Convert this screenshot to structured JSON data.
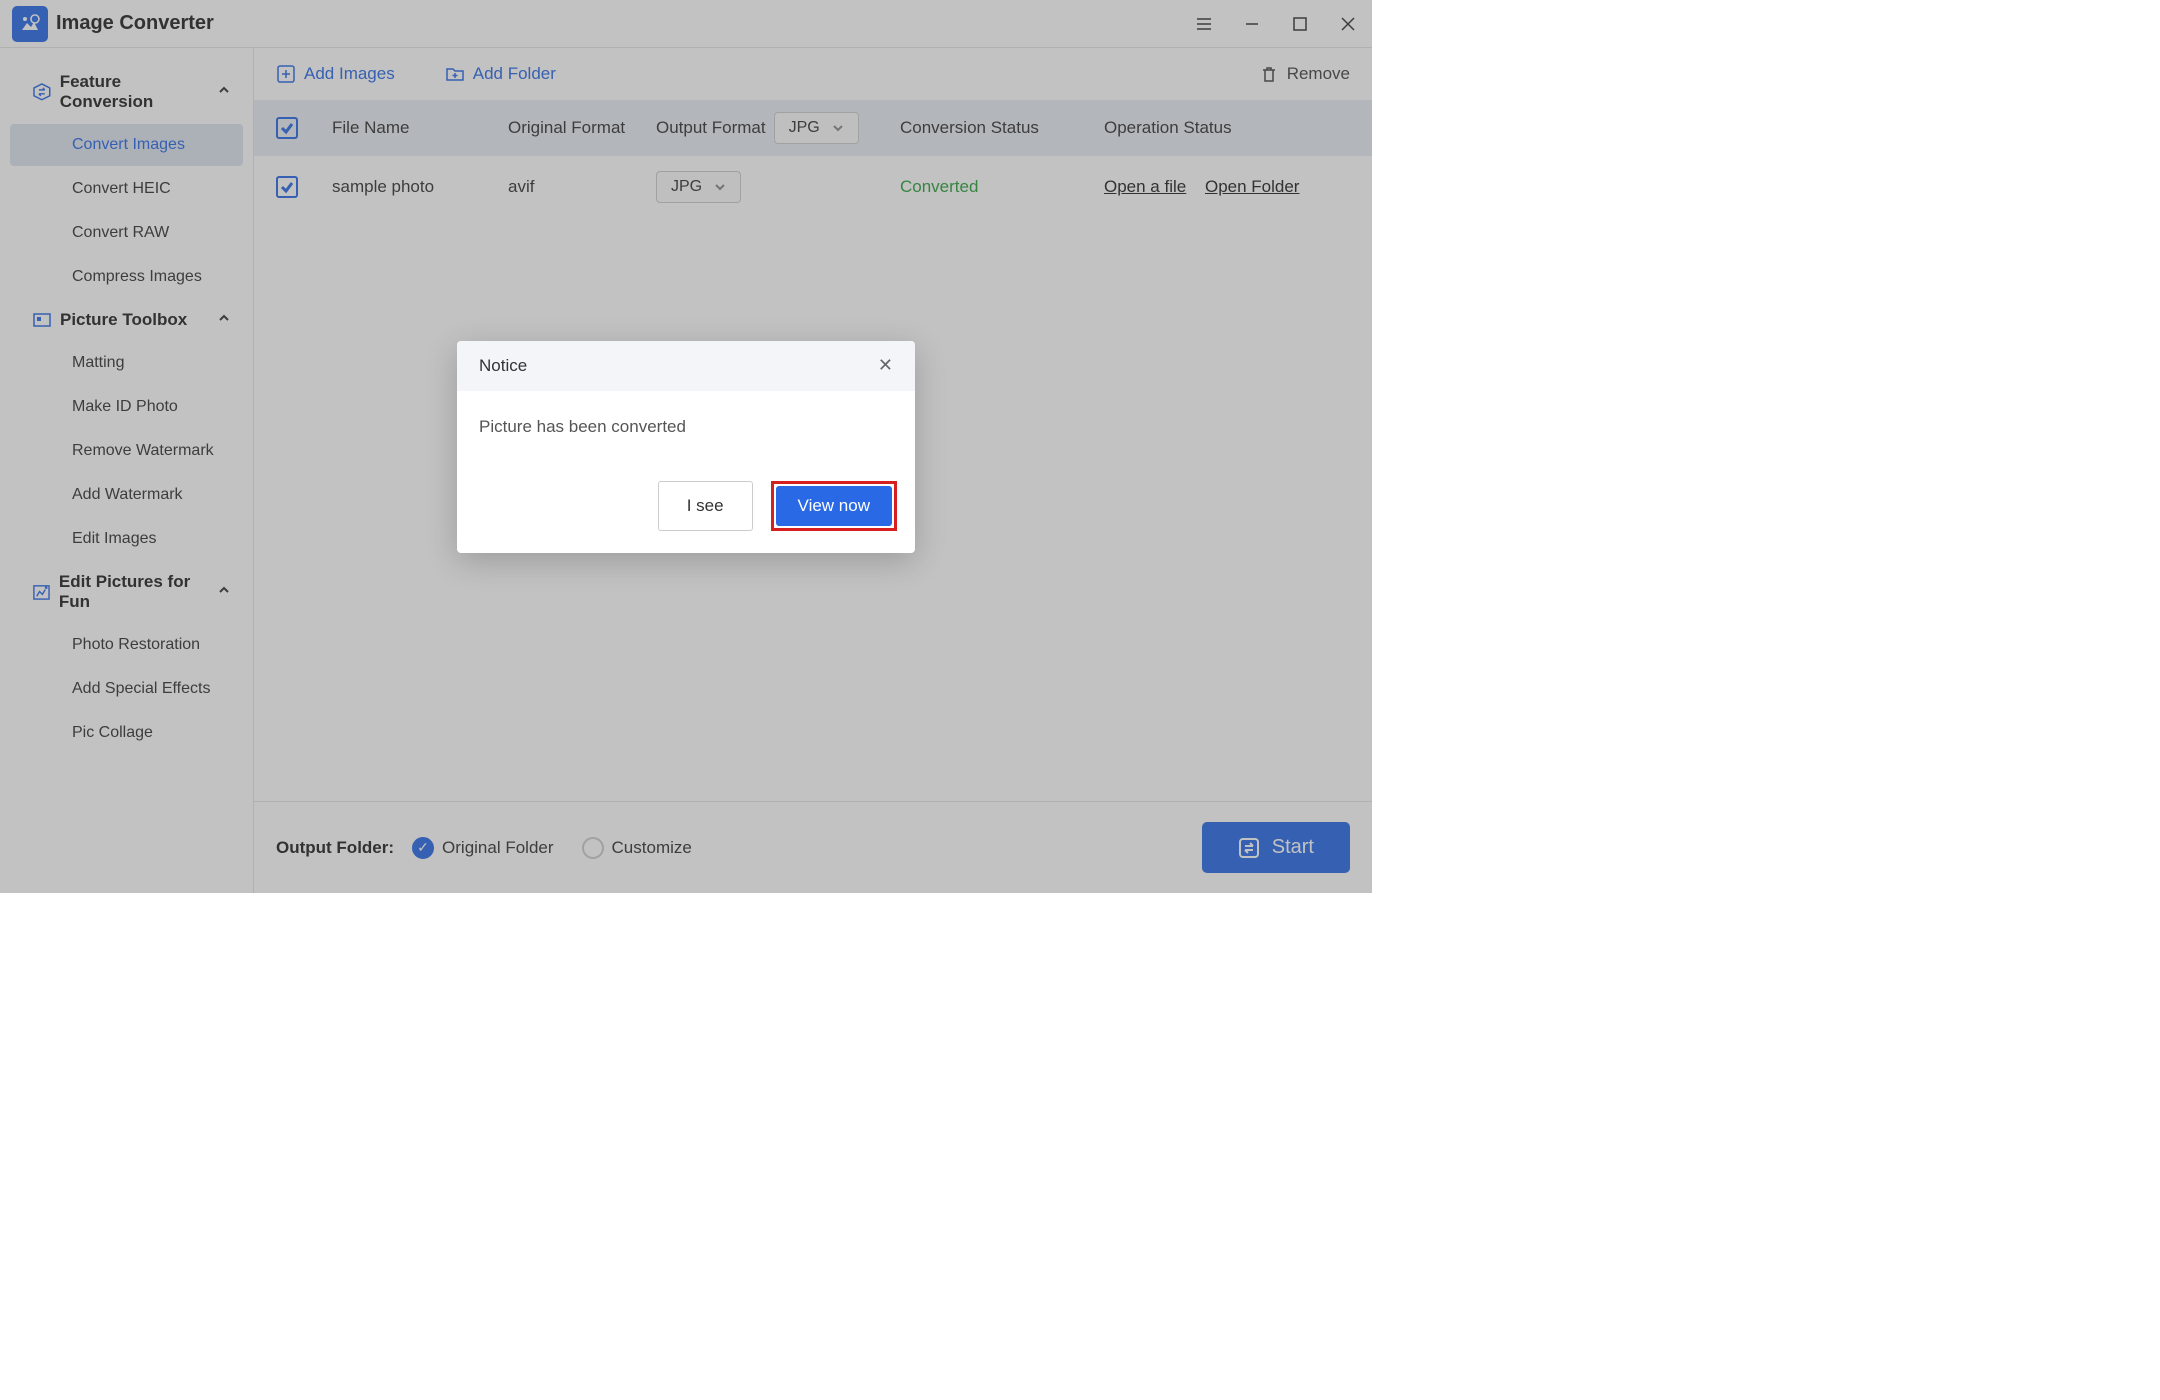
{
  "app_title": "Image Converter",
  "sidebar": {
    "sections": [
      {
        "label": "Feature Conversion",
        "items": [
          "Convert Images",
          "Convert HEIC",
          "Convert RAW",
          "Compress Images"
        ],
        "active_index": 0
      },
      {
        "label": "Picture Toolbox",
        "items": [
          "Matting",
          "Make ID Photo",
          "Remove Watermark",
          "Add Watermark",
          "Edit Images"
        ]
      },
      {
        "label": "Edit Pictures for Fun",
        "items": [
          "Photo Restoration",
          "Add Special Effects",
          "Pic Collage"
        ]
      }
    ]
  },
  "toolbar": {
    "add_images": "Add Images",
    "add_folder": "Add Folder",
    "remove": "Remove"
  },
  "table": {
    "header": {
      "file_name": "File Name",
      "original": "Original Format",
      "output": "Output Format",
      "output_select": "JPG",
      "status": "Conversion Status",
      "operation": "Operation Status"
    },
    "rows": [
      {
        "name": "sample photo",
        "original": "avif",
        "output": "JPG",
        "status": "Converted",
        "op1": "Open a file",
        "op2": "Open Folder"
      }
    ]
  },
  "footer": {
    "label": "Output Folder:",
    "opt1": "Original Folder",
    "opt2": "Customize",
    "start": "Start"
  },
  "modal": {
    "title": "Notice",
    "body": "Picture has been converted",
    "cancel": "I see",
    "ok": "View now"
  }
}
